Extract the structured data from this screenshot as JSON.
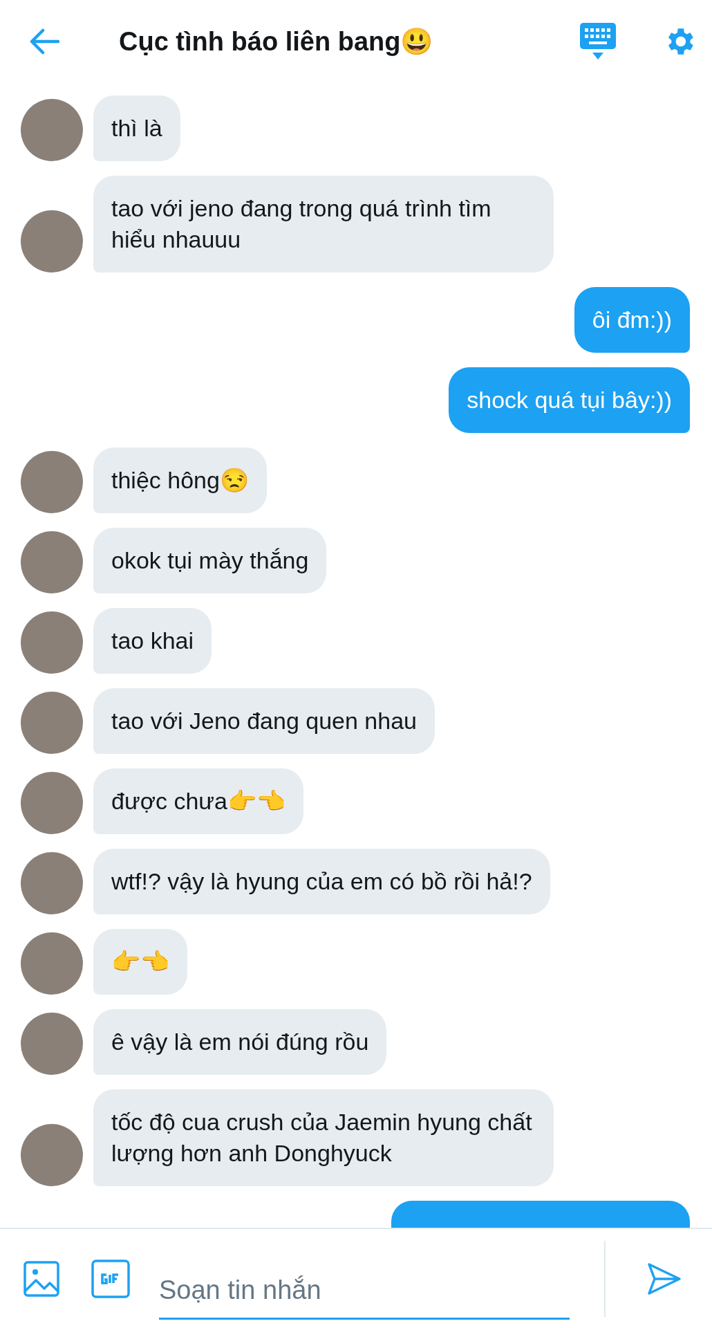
{
  "header": {
    "title": "Cục tình báo liên bang😃"
  },
  "messages": [
    {
      "kind": "received",
      "text": "thì là"
    },
    {
      "kind": "received",
      "text": "tao với jeno đang trong quá trình tìm hiểu nhauuu"
    },
    {
      "kind": "sent",
      "text": "ôi đm:))"
    },
    {
      "kind": "sent",
      "text": "shock quá tụi bây:))"
    },
    {
      "kind": "received",
      "text": "thiệc hông😒"
    },
    {
      "kind": "received",
      "text": "okok tụi mày thắng"
    },
    {
      "kind": "received",
      "text": "tao khai"
    },
    {
      "kind": "received",
      "text": "tao với Jeno đang quen nhau"
    },
    {
      "kind": "received",
      "text": "được chưa👉👈"
    },
    {
      "kind": "received",
      "text": "wtf!? vậy là hyung của em có bồ rồi hả!?"
    },
    {
      "kind": "received",
      "text": "👉👈"
    },
    {
      "kind": "received",
      "text": "ê vậy là em nói đúng rồu"
    },
    {
      "kind": "received",
      "text": "tốc độ cua crush của Jaemin hyung chất lượng hơn anh Donghyuck"
    },
    {
      "kind": "sent"
    }
  ],
  "composer": {
    "placeholder": "Soạn tin nhắn"
  }
}
